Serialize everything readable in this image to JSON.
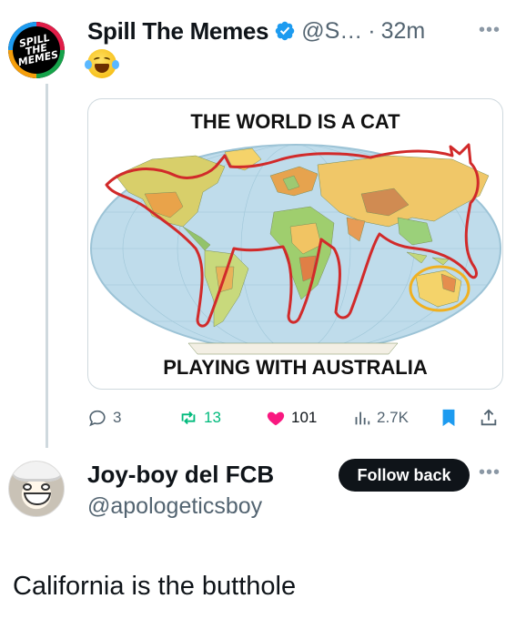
{
  "tweet": {
    "avatar_text": "SPILL THE MEMES",
    "author_name": "Spill The Memes",
    "verified_icon": "verified-badge-icon",
    "handle": "@S…",
    "separator": "·",
    "time": "32m",
    "emoji_icon": "face-with-tears-of-joy-icon",
    "meme": {
      "top_text": "THE WORLD IS A CAT",
      "bottom_text": "PLAYING WITH AUSTRALIA"
    },
    "actions": {
      "replies": "3",
      "reposts": "13",
      "likes": "101",
      "views": "2.7K"
    }
  },
  "reply": {
    "author_name": "Joy-boy del FCB",
    "handle": "@apologeticsboy",
    "follow_label": "Follow back",
    "text": "California is the butthole"
  },
  "colors": {
    "text": "#0f1419",
    "muted": "#536471",
    "verified": "#1d9bf0",
    "like": "#f91880",
    "repost": "#00ba7c",
    "bookmark": "#1d9bf0",
    "cat_outline": "#d12a2a"
  }
}
